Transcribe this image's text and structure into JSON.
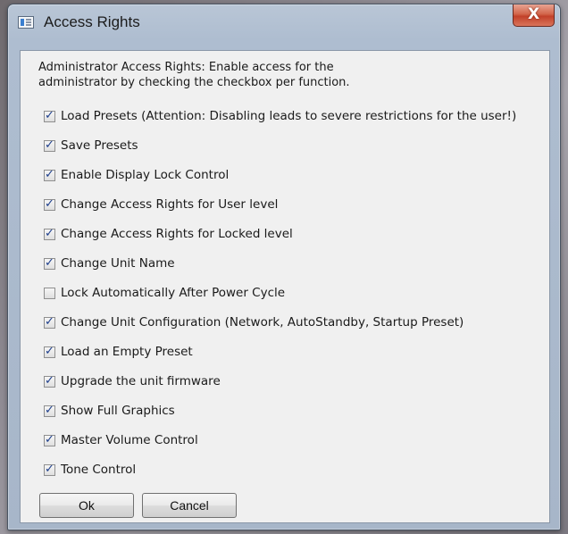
{
  "window": {
    "title": "Access Rights",
    "close_label": "X"
  },
  "description": "Administrator Access Rights: Enable access for the\nadministrator by checking the checkbox per function.",
  "options": [
    {
      "label": "Load Presets (Attention: Disabling leads to severe restrictions for the user!)",
      "checked": true
    },
    {
      "label": "Save Presets",
      "checked": true
    },
    {
      "label": "Enable Display Lock Control",
      "checked": true
    },
    {
      "label": "Change Access Rights for User level",
      "checked": true
    },
    {
      "label": "Change Access Rights for Locked level",
      "checked": true
    },
    {
      "label": "Change Unit Name",
      "checked": true
    },
    {
      "label": "Lock Automatically After Power Cycle",
      "checked": false
    },
    {
      "label": "Change Unit Configuration (Network, AutoStandby, Startup Preset)",
      "checked": true
    },
    {
      "label": "Load an Empty Preset",
      "checked": true
    },
    {
      "label": "Upgrade the unit firmware",
      "checked": true
    },
    {
      "label": "Show Full Graphics",
      "checked": true
    },
    {
      "label": "Master Volume Control",
      "checked": true
    },
    {
      "label": "Tone Control",
      "checked": true
    }
  ],
  "buttons": {
    "ok": "Ok",
    "cancel": "Cancel"
  }
}
